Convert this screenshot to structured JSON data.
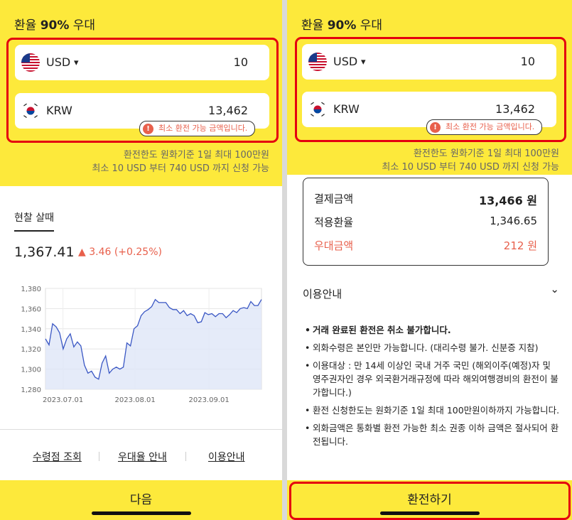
{
  "left": {
    "headline_prefix": "환율 ",
    "headline_bold": "90%",
    "headline_suffix": " 우대",
    "usd_label": "USD",
    "usd_amount": "10",
    "krw_label": "KRW",
    "krw_amount": "13,462",
    "warning": "최소 환전 가능 금액입니다.",
    "limit_line1": "환전한도 원화기준 1일 최대 100만원",
    "limit_line2": "최소 10 USD 부터 740 USD 까지 신청 가능",
    "tab_label": "현찰 살때",
    "current_rate": "1,367.41",
    "change_text": "▲ 3.46 (+0.25%)",
    "links": [
      "수령점 조회",
      "우대율 안내",
      "이용안내"
    ],
    "next_button": "다음"
  },
  "right": {
    "headline_prefix": "환율 ",
    "headline_bold": "90%",
    "headline_suffix": " 우대",
    "usd_label": "USD",
    "usd_amount": "10",
    "krw_label": "KRW",
    "krw_amount": "13,462",
    "warning": "최소 환전 가능 금액입니다.",
    "limit_line1": "환전한도 원화기준 1일 최대 100만원",
    "limit_line2": "최소 10 USD 부터 740 USD 까지 신청 가능",
    "pay_label": "결제금액",
    "pay_value": "13,466 원",
    "applied_rate_label": "적용환율",
    "applied_rate_value": "1,346.65",
    "discount_label": "우대금액",
    "discount_value": "212 원",
    "guide_title": "이용안내",
    "notes": [
      "거래 완료된 환전은 취소 불가합니다.",
      "외화수령은 본인만 가능합니다. (대리수령 불가. 신분증 지참)",
      "이용대상 : 만 14세 이상인 국내 거주 국민 (해외이주(예정)자 및 영주권자인 경우 외국환거래규정에 따라 해외여행경비의 환전이 불가합니다.)",
      "환전 신청한도는 원화기준 1일 최대 100만원이하까지 가능합니다.",
      "외화금액은 통화별 환전 가능한 최소 권종 이하 금액은 절사되어 환전됩니다."
    ],
    "exchange_button": "환전하기"
  },
  "colors": {
    "yellow": "#fde93b",
    "accent_red": "#e8604c",
    "highlight_red": "#e4000f",
    "line": "#3a57c4"
  },
  "chart_data": {
    "type": "area",
    "title": "",
    "xlabel": "",
    "ylabel": "",
    "x_tick_labels": [
      "2023.07.01",
      "2023.08.01",
      "2023.09.01"
    ],
    "y_tick_labels": [
      "1,380",
      "1,360",
      "1,340",
      "1,320",
      "1,300",
      "1,280"
    ],
    "ylim": [
      1280,
      1380
    ],
    "grid": true,
    "series": [
      {
        "values": [
          1330,
          1324,
          1345,
          1342,
          1336,
          1320,
          1330,
          1335,
          1322,
          1327,
          1323,
          1304,
          1296,
          1298,
          1292,
          1290,
          1306,
          1313,
          1296,
          1300,
          1302,
          1300,
          1302,
          1326,
          1323,
          1340,
          1343,
          1353,
          1357,
          1359,
          1362,
          1369,
          1366,
          1366,
          1366,
          1361,
          1359,
          1359,
          1355,
          1358,
          1353,
          1355,
          1353,
          1346,
          1347,
          1356,
          1354,
          1355,
          1352,
          1355,
          1355,
          1351,
          1354,
          1358,
          1356,
          1360,
          1361,
          1360,
          1367,
          1363,
          1363,
          1369
        ]
      }
    ]
  }
}
